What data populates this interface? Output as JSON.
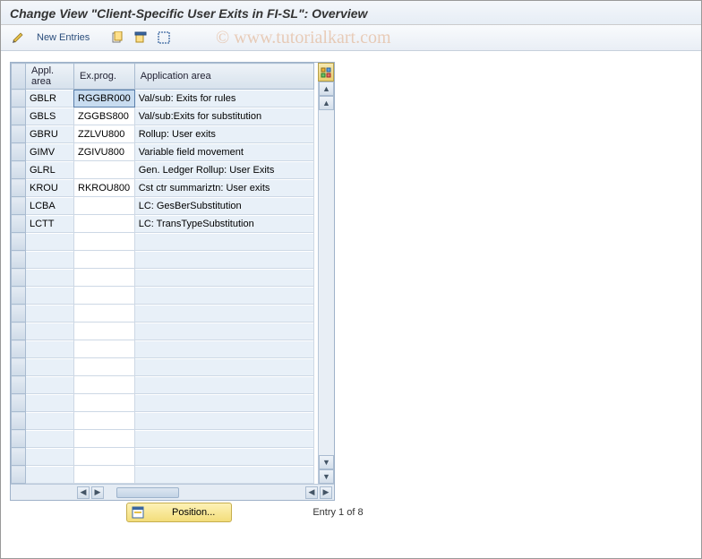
{
  "title": "Change View \"Client-Specific User Exits in FI-SL\": Overview",
  "watermark": "© www.tutorialkart.com",
  "toolbar": {
    "new_entries": "New Entries"
  },
  "columns": {
    "appl_area": "Appl. area",
    "ex_prog": "Ex.prog.",
    "application_area": "Application area"
  },
  "rows": [
    {
      "appl": "GBLR",
      "prog": "RGGBR000",
      "desc": "Val/sub: Exits for rules",
      "selected": true
    },
    {
      "appl": "GBLS",
      "prog": "ZGGBS800",
      "desc": "Val/sub:Exits for substitution"
    },
    {
      "appl": "GBRU",
      "prog": "ZZLVU800",
      "desc": "Rollup: User exits"
    },
    {
      "appl": "GIMV",
      "prog": "ZGIVU800",
      "desc": "Variable field movement"
    },
    {
      "appl": "GLRL",
      "prog": "",
      "desc": "Gen. Ledger Rollup: User Exits"
    },
    {
      "appl": "KROU",
      "prog": "RKROU800",
      "desc": "Cst ctr summariztn: User exits"
    },
    {
      "appl": "LCBA",
      "prog": "",
      "desc": "LC: GesBerSubstitution"
    },
    {
      "appl": "LCTT",
      "prog": "",
      "desc": "LC: TransTypeSubstitution"
    }
  ],
  "empty_rows": 14,
  "position_button": "Position...",
  "entry_status": "Entry 1 of 8"
}
